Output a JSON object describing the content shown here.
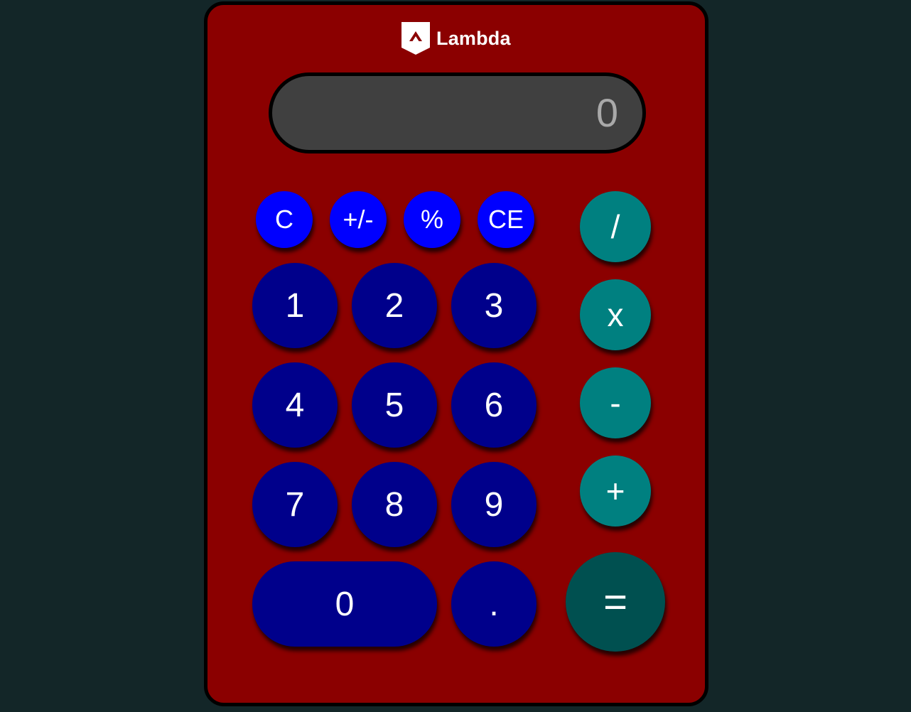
{
  "brand": {
    "name": "Lambda",
    "logo_icon": "lambda-shield-icon"
  },
  "display": {
    "value": "0"
  },
  "functions": [
    {
      "label": "C"
    },
    {
      "label": "+/-"
    },
    {
      "label": "%"
    },
    {
      "label": "CE"
    }
  ],
  "numbers": {
    "one": "1",
    "two": "2",
    "three": "3",
    "four": "4",
    "five": "5",
    "six": "6",
    "seven": "7",
    "eight": "8",
    "nine": "9",
    "zero": "0",
    "decimal": "."
  },
  "operators": {
    "divide": "/",
    "multiply": "x",
    "subtract": "-",
    "add": "+",
    "equals": "="
  },
  "colors": {
    "body": "#8b0000",
    "display": "#404040",
    "function_buttons": "#0000ff",
    "number_buttons": "#00008b",
    "operator_buttons": "#008080",
    "equals_button": "#005050",
    "background": "#132628"
  }
}
